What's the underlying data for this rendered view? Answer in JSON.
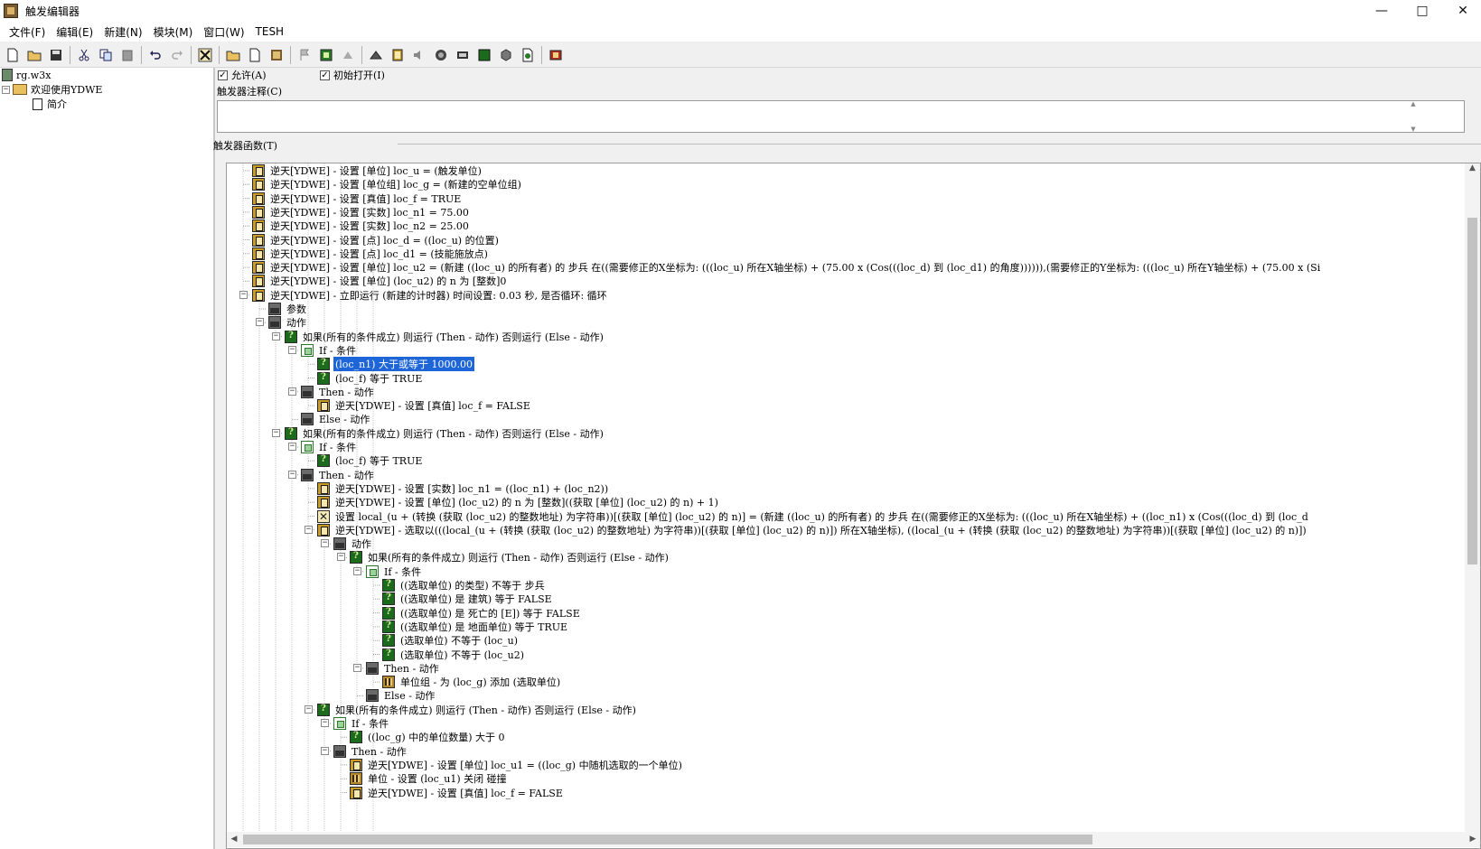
{
  "window": {
    "title": "触发编辑器"
  },
  "menu": [
    "文件(F)",
    "编辑(E)",
    "新建(N)",
    "模块(M)",
    "窗口(W)",
    "TESH"
  ],
  "toolbar_icons": [
    "new-icon",
    "open-icon",
    "save-icon",
    "cut-icon",
    "copy-icon",
    "paste-icon",
    "undo-icon",
    "redo-icon",
    "delete-icon",
    "new-category-icon",
    "new-trigger-icon",
    "new-event-icon",
    "test-map-icon",
    "terrain-editor-icon",
    "trigger-editor-icon",
    "unit-editor-icon",
    "sound-editor-icon",
    "object-editor-icon",
    "ai-editor-icon",
    "import-manager-icon",
    "object-palette-icon",
    "script-icon",
    "campaign-icon"
  ],
  "left_tree": {
    "map": "rg.w3x",
    "folder": "欢迎使用YDWE",
    "trigger": "简介"
  },
  "props": {
    "enabled_label": "允许(A)",
    "enabled": true,
    "initially_on_label": "初始打开(I)",
    "initially_on": true,
    "comment_label": "触发器注释(C)",
    "comment": "",
    "functions_label": "触发器函数(T)"
  },
  "tree_rows": [
    {
      "text": "逆天[YDWE] - 设置 [单位] loc_u = (触发单位)"
    },
    {
      "text": "逆天[YDWE] - 设置 [单位组] loc_g = (新建的空单位组)"
    },
    {
      "text": "逆天[YDWE] - 设置 [真值] loc_f = TRUE"
    },
    {
      "text": "逆天[YDWE] - 设置 [实数] loc_n1 = 75.00"
    },
    {
      "text": "逆天[YDWE] - 设置 [实数] loc_n2 = 25.00"
    },
    {
      "text": "逆天[YDWE] - 设置 [点] loc_d = ((loc_u) 的位置)"
    },
    {
      "text": "逆天[YDWE] - 设置 [点] loc_d1 = (技能施放点)"
    },
    {
      "text": "逆天[YDWE] - 设置 [单位] loc_u2 = (新建 ((loc_u) 的所有者) 的 步兵 在((需要修正的X坐标为: (((loc_u) 所在X轴坐标) + (75.00 x (Cos(((loc_d) 到 (loc_d1) 的角度)))))),(需要修正的Y坐标为: (((loc_u) 所在Y轴坐标) + (75.00 x (Si"
    },
    {
      "text": "逆天[YDWE] - 设置 [单位] (loc_u2) 的 n 为 [整数]0"
    },
    {
      "text": "逆天[YDWE] - 立即运行 (新建的计时器) 时间设置: 0.03 秒, 是否循环: 循环"
    },
    {
      "text": "参数"
    },
    {
      "text": "动作"
    },
    {
      "text": "如果(所有的条件成立) 则运行 (Then - 动作) 否则运行 (Else - 动作)"
    },
    {
      "text": "If - 条件"
    },
    {
      "text": "(loc_n1) 大于或等于 1000.00"
    },
    {
      "text": "(loc_f) 等于 TRUE"
    },
    {
      "text": "Then - 动作"
    },
    {
      "text": "逆天[YDWE] - 设置 [真值] loc_f = FALSE"
    },
    {
      "text": "Else - 动作"
    },
    {
      "text": "如果(所有的条件成立) 则运行 (Then - 动作) 否则运行 (Else - 动作)"
    },
    {
      "text": "If - 条件"
    },
    {
      "text": "(loc_f) 等于 TRUE"
    },
    {
      "text": "Then - 动作"
    },
    {
      "text": "逆天[YDWE] - 设置 [实数] loc_n1 = ((loc_n1) + (loc_n2))"
    },
    {
      "text": "逆天[YDWE] - 设置 [单位] (loc_u2) 的 n 为 [整数]((获取 [单位] (loc_u2) 的 n) + 1)"
    },
    {
      "text": "设置 local_(u + (转换 (获取 (loc_u2) 的整数地址) 为字符串))[(获取 [单位] (loc_u2) 的 n)] = (新建 ((loc_u) 的所有者) 的 步兵 在((需要修正的X坐标为: (((loc_u) 所在X轴坐标) + ((loc_n1) x (Cos(((loc_d) 到 (loc_d"
    },
    {
      "text": "逆天[YDWE] - 选取以(((local_(u + (转换 (获取 (loc_u2) 的整数地址) 为字符串))[(获取 [单位] (loc_u2) 的 n)]) 所在X轴坐标), ((local_(u + (转换 (获取 (loc_u2) 的整数地址) 为字符串))[(获取 [单位] (loc_u2) 的 n)])"
    },
    {
      "text": "动作"
    },
    {
      "text": "如果(所有的条件成立) 则运行 (Then - 动作) 否则运行 (Else - 动作)"
    },
    {
      "text": "If - 条件"
    },
    {
      "text": "((选取单位) 的类型) 不等于 步兵"
    },
    {
      "text": "((选取单位) 是 建筑) 等于 FALSE"
    },
    {
      "text": "((选取单位) 是 死亡的 [E]) 等于 FALSE"
    },
    {
      "text": "((选取单位) 是 地面单位) 等于 TRUE"
    },
    {
      "text": "(选取单位) 不等于 (loc_u)"
    },
    {
      "text": "(选取单位) 不等于 (loc_u2)"
    },
    {
      "text": "Then - 动作"
    },
    {
      "text": "单位组 - 为 (loc_g) 添加 (选取单位)"
    },
    {
      "text": "Else - 动作"
    },
    {
      "text": "如果(所有的条件成立) 则运行 (Then - 动作) 否则运行 (Else - 动作)"
    },
    {
      "text": "If - 条件"
    },
    {
      "text": "((loc_g) 中的单位数量) 大于 0"
    },
    {
      "text": "Then - 动作"
    },
    {
      "text": "逆天[YDWE] - 设置 [单位] loc_u1 = ((loc_g) 中随机选取的一个单位)"
    },
    {
      "text": "单位 - 设置 (loc_u1) 关闭 碰撞"
    },
    {
      "text": "逆天[YDWE] - 设置 [真值] loc_f = FALSE"
    }
  ]
}
